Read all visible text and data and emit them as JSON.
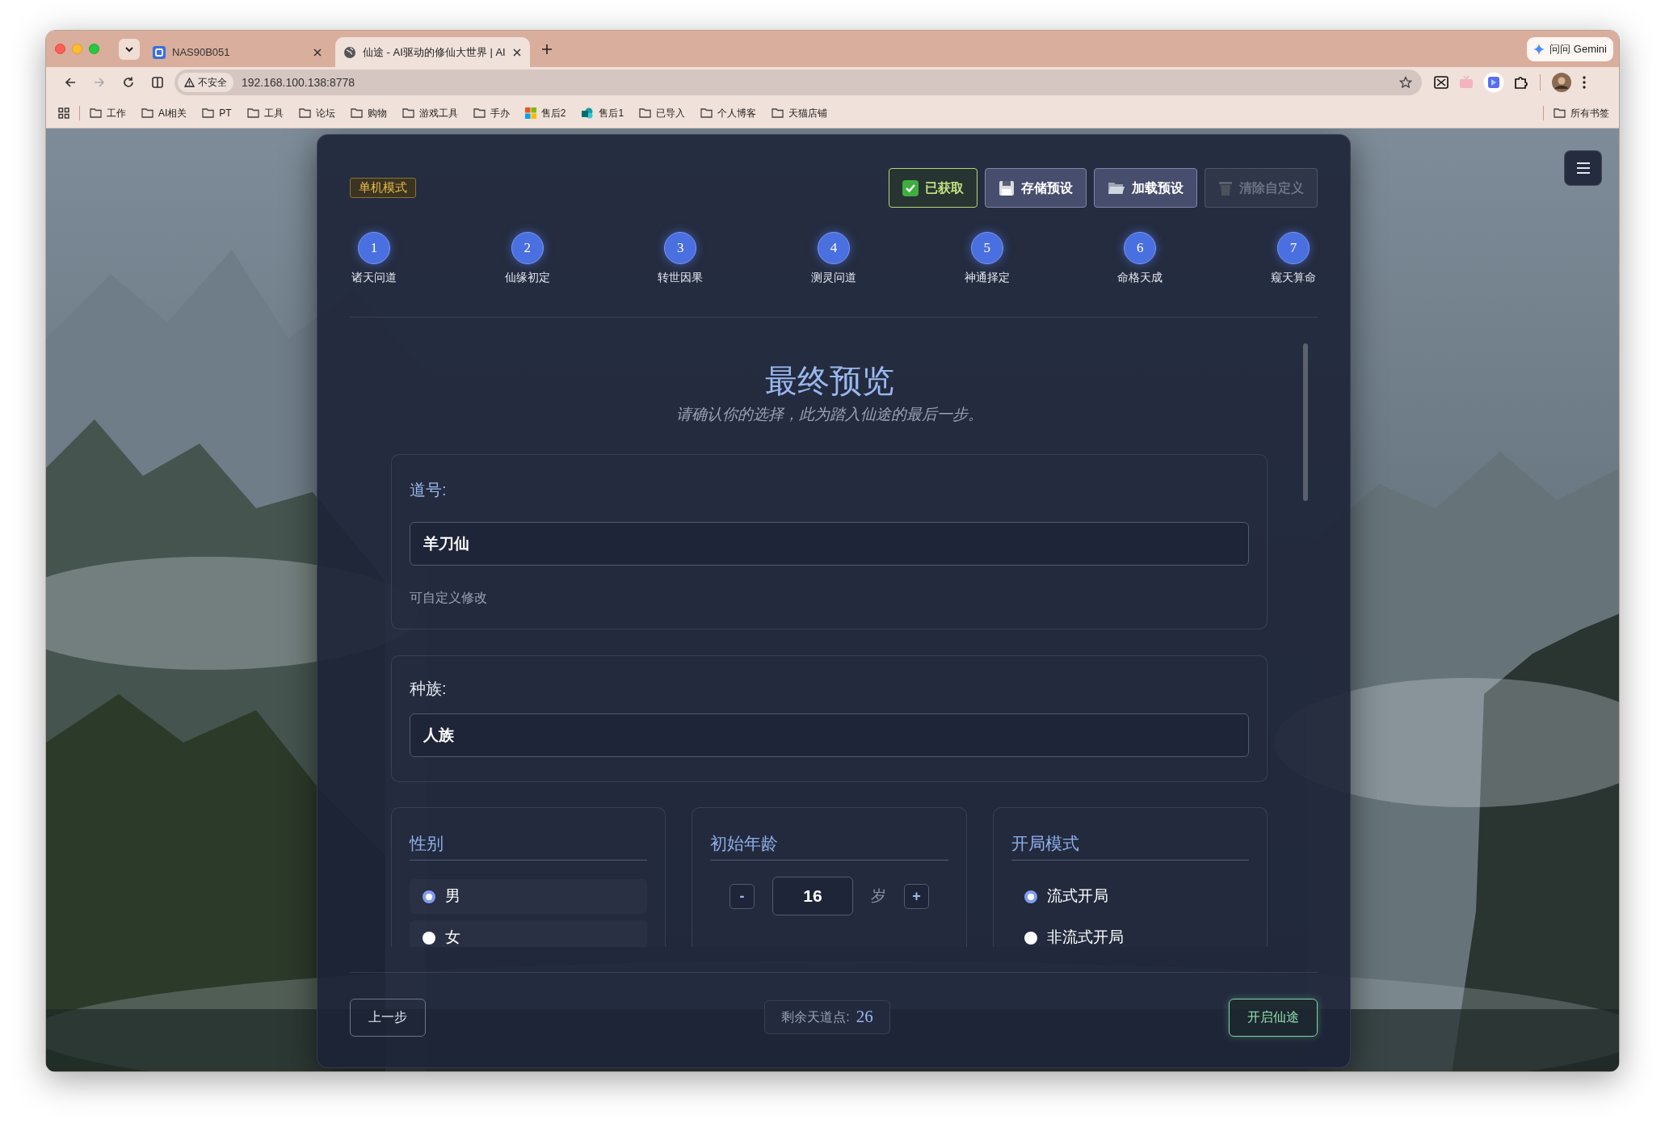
{
  "browser": {
    "tabs": [
      {
        "title": "NAS90B051",
        "selected": false
      },
      {
        "title": "仙途 - AI驱动的修仙大世界 | AI",
        "selected": true
      }
    ],
    "gemini_button": "问问 Gemini",
    "address": {
      "security": "不安全",
      "url": "192.168.100.138:8778"
    },
    "bookmarks": [
      {
        "label": "工作",
        "kind": "folder"
      },
      {
        "label": "AI相关",
        "kind": "folder"
      },
      {
        "label": "PT",
        "kind": "folder"
      },
      {
        "label": "工具",
        "kind": "folder"
      },
      {
        "label": "论坛",
        "kind": "folder"
      },
      {
        "label": "购物",
        "kind": "folder"
      },
      {
        "label": "游戏工具",
        "kind": "folder"
      },
      {
        "label": "手办",
        "kind": "folder"
      },
      {
        "label": "售后2",
        "kind": "squares"
      },
      {
        "label": "售后1",
        "kind": "circles"
      },
      {
        "label": "已导入",
        "kind": "folder"
      },
      {
        "label": "个人博客",
        "kind": "folder"
      },
      {
        "label": "天猫店铺",
        "kind": "folder"
      }
    ],
    "all_bookmarks": "所有书签"
  },
  "app": {
    "mode_badge": "单机模式",
    "actions": [
      {
        "label": "已获取",
        "kind": "success"
      },
      {
        "label": "存储预设",
        "kind": "default"
      },
      {
        "label": "加载预设",
        "kind": "default"
      },
      {
        "label": "清除自定义",
        "kind": "disabled"
      }
    ],
    "steps": [
      {
        "number": "1",
        "label": "诸天问道"
      },
      {
        "number": "2",
        "label": "仙缘初定"
      },
      {
        "number": "3",
        "label": "转世因果"
      },
      {
        "number": "4",
        "label": "测灵问道"
      },
      {
        "number": "5",
        "label": "神通择定"
      },
      {
        "number": "6",
        "label": "命格天成"
      },
      {
        "number": "7",
        "label": "窥天算命"
      }
    ],
    "title": "最终预览",
    "subtitle": "请确认你的选择，此为踏入仙途的最后一步。",
    "name_card": {
      "label": "道号:",
      "value": "羊刀仙",
      "hint": "可自定义修改"
    },
    "race_card": {
      "label": "种族:",
      "value": "人族"
    },
    "gender": {
      "title": "性别",
      "options": [
        {
          "label": "男",
          "selected": true
        },
        {
          "label": "女",
          "selected": false
        }
      ]
    },
    "age": {
      "title": "初始年龄",
      "minus": "-",
      "value": "16",
      "unit": "岁",
      "plus": "+"
    },
    "start_mode": {
      "title": "开局模式",
      "options": [
        {
          "label": "流式开局",
          "selected": true
        },
        {
          "label": "非流式开局",
          "selected": false
        }
      ]
    },
    "footer": {
      "back": "上一步",
      "points_label": "剩余天道点:",
      "points": "26",
      "start": "开启仙途"
    }
  }
}
